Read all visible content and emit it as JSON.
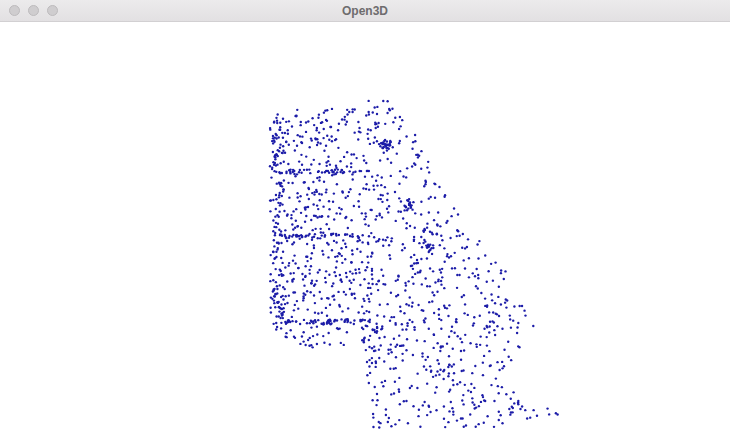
{
  "window": {
    "title": "Open3D"
  }
}
